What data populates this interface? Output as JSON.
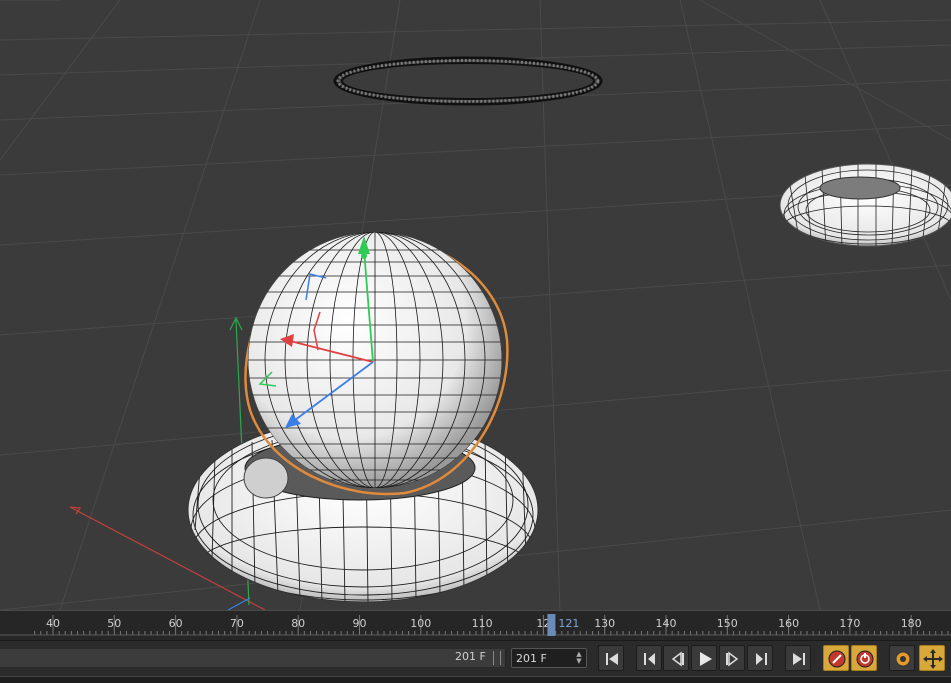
{
  "timeline": {
    "ticks": [
      "40",
      "50",
      "60",
      "70",
      "80",
      "90",
      "100",
      "110",
      "12",
      "130",
      "140",
      "150",
      "160",
      "170",
      "180"
    ],
    "current_frame": "121"
  },
  "transport": {
    "end_frame_label": "201 F",
    "end_frame_value": "201 F"
  },
  "colors": {
    "selection_outline": "#e08a3c",
    "axis_y": "#2ecc55",
    "axis_x": "#e04040",
    "axis_z": "#3a7fe8",
    "playhead": "#6a8bb8",
    "active_button": "#d8a93a"
  },
  "icons": {
    "goto_start": "skip-to-start-icon",
    "prev_key": "previous-key-icon",
    "prev_frame": "previous-frame-icon",
    "play": "play-icon",
    "next_frame": "next-frame-icon",
    "next_key": "next-key-icon",
    "goto_end": "skip-to-end-icon",
    "record": "record-keys-icon",
    "autokey": "autokey-icon",
    "keyframe_settings": "gear-icon",
    "move_tool": "move-tool-icon"
  }
}
